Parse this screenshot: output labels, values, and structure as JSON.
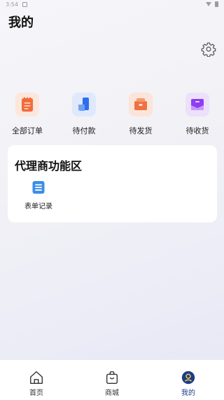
{
  "status_bar": {
    "time": "3:54"
  },
  "header": {
    "title": "我的",
    "settings_icon": "gear-icon"
  },
  "orders": [
    {
      "label": "全部订单",
      "icon": "clipboard-icon",
      "color": "#f36b3c"
    },
    {
      "label": "待付款",
      "icon": "wallet-icon",
      "color": "#2f6df0"
    },
    {
      "label": "待发货",
      "icon": "box-icon",
      "color": "#f07040"
    },
    {
      "label": "待收货",
      "icon": "parcel-icon",
      "color": "#8d3ef0"
    }
  ],
  "agent_section": {
    "title": "代理商功能区",
    "items": [
      {
        "label": "表单记录",
        "icon": "form-list-icon",
        "color": "#3a8ee8"
      }
    ]
  },
  "tabbar": {
    "items": [
      {
        "label": "首页",
        "icon": "home-icon",
        "active": false
      },
      {
        "label": "商城",
        "icon": "shopping-bag-icon",
        "active": false
      },
      {
        "label": "我的",
        "icon": "profile-icon",
        "active": true
      }
    ],
    "active_color": "#1d3e86"
  }
}
